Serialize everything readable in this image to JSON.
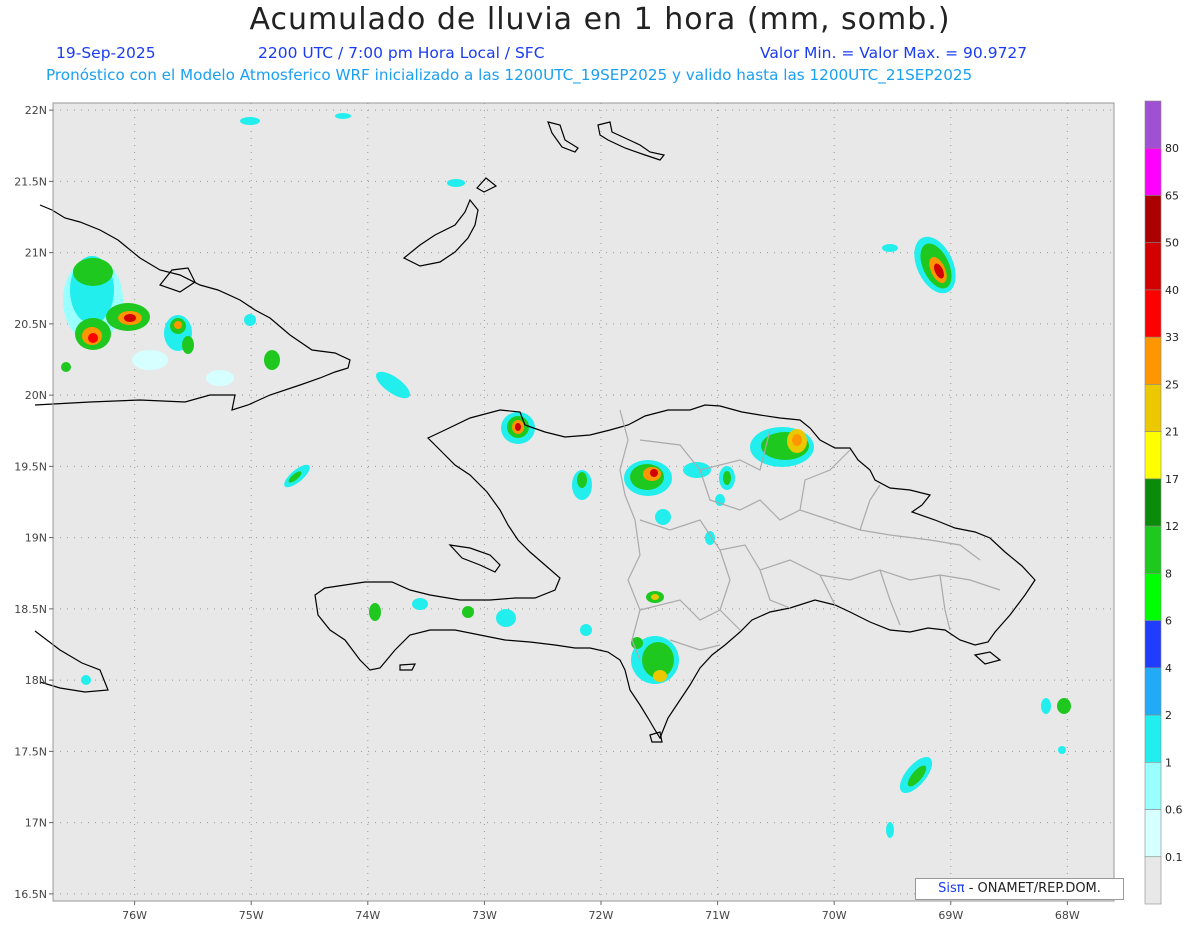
{
  "header": {
    "title": "Acumulado de lluvia en 1 hora (mm, somb.)",
    "date": "19-Sep-2025",
    "time": "2200 UTC / 7:00 pm Hora Local / SFC",
    "minmax": "Valor Min. =   Valor Max. = 90.9727",
    "forecast": "Pronóstico con el Modelo Atmosferico WRF inicializado a las 1200UTC_19SEP2025 y valido hasta las  1200UTC_21SEP2025"
  },
  "map": {
    "lon_labels": [
      "76W",
      "75W",
      "74W",
      "73W",
      "72W",
      "71W",
      "70W",
      "69W",
      "68W"
    ],
    "lat_labels": [
      "22N",
      "21.5N",
      "21N",
      "20.5N",
      "20N",
      "19.5N",
      "19N",
      "18.5N",
      "18N",
      "17.5N",
      "17N",
      "16.5N"
    ],
    "lon_range": [
      -76.7,
      -67.6
    ],
    "lat_range": [
      16.45,
      22.05
    ]
  },
  "colorbar": {
    "levels": [
      "0.1",
      "0.6",
      "1",
      "2",
      "4",
      "6",
      "8",
      "12",
      "17",
      "21",
      "25",
      "33",
      "40",
      "50",
      "65",
      "80"
    ],
    "colors": [
      "#e8e8e8",
      "#d6ffff",
      "#99ffff",
      "#22eeee",
      "#20aaf8",
      "#1f3cff",
      "#00ff00",
      "#1fc81f",
      "#0a8c0a",
      "#ffff00",
      "#ebc800",
      "#ff9600",
      "#ff0000",
      "#d20000",
      "#aa0000",
      "#ff00ff",
      "#a050d2"
    ]
  },
  "credit": {
    "brand": "Sisπ",
    "org": " - ONAMET/REP.DOM."
  }
}
